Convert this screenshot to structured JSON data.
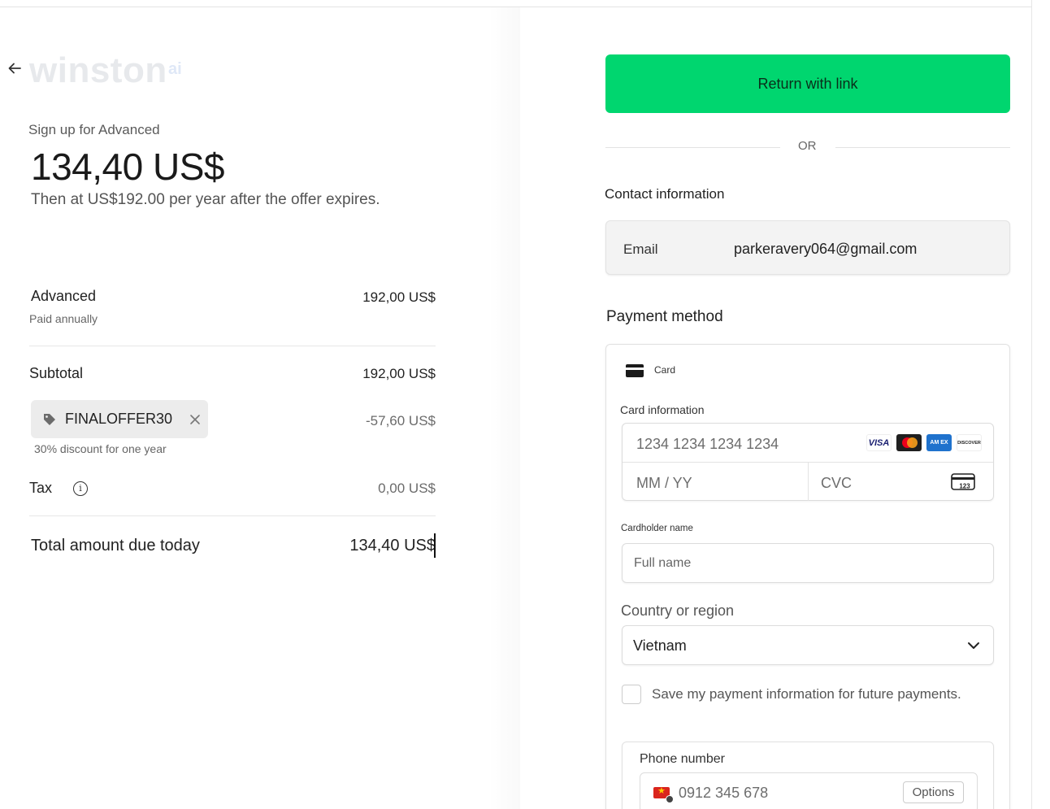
{
  "brand": {
    "name": "winston",
    "suffix": "ai"
  },
  "summary": {
    "signup_text": "Sign up for Advanced",
    "price": "134,40 US$",
    "renewal_text": "Then at US$192.00 per year after the offer expires."
  },
  "line_items": {
    "plan_name": "Advanced",
    "plan_billing": "Paid annually",
    "plan_price": "192,00 US$",
    "subtotal_label": "Subtotal",
    "subtotal_value": "192,00 US$",
    "promo_code": "FINALOFFER30",
    "promo_discount": "-57,60 US$",
    "promo_desc": "30% discount for one year",
    "tax_label": "Tax",
    "tax_value": "0,00 US$",
    "total_label": "Total amount due today",
    "total_value": "134,40 US$"
  },
  "checkout": {
    "link_button": "Return with link",
    "or_text": "OR",
    "contact_heading": "Contact information",
    "email_label": "Email",
    "email_value": "parkeravery064@gmail.com",
    "payment_heading": "Payment method",
    "card_tab": "Card",
    "card_info_label": "Card information",
    "card_number_placeholder": "1234 1234 1234 1234",
    "expiry_placeholder": "MM / YY",
    "cvc_placeholder": "CVC",
    "cvc_icon_text": "123",
    "cardholder_label": "Cardholder name",
    "fullname_placeholder": "Full name",
    "country_label": "Country or region",
    "country_value": "Vietnam",
    "save_info_text": "Save my payment information for future payments.",
    "phone_label": "Phone number",
    "phone_placeholder": "0912 345 678",
    "phone_options": "Options"
  },
  "card_brands": {
    "visa": "VISA",
    "amex": "AM EX",
    "discover": "DISCOVER"
  },
  "colors": {
    "link_green": "#00d66f",
    "text_primary": "#1a1a1a",
    "border": "#dcdcdc"
  },
  "icons": [
    "arrow-left-icon",
    "tag-icon",
    "close-icon",
    "info-icon",
    "card-icon",
    "cvc-card-icon",
    "chevron-down-icon",
    "vietnam-flag-icon"
  ]
}
